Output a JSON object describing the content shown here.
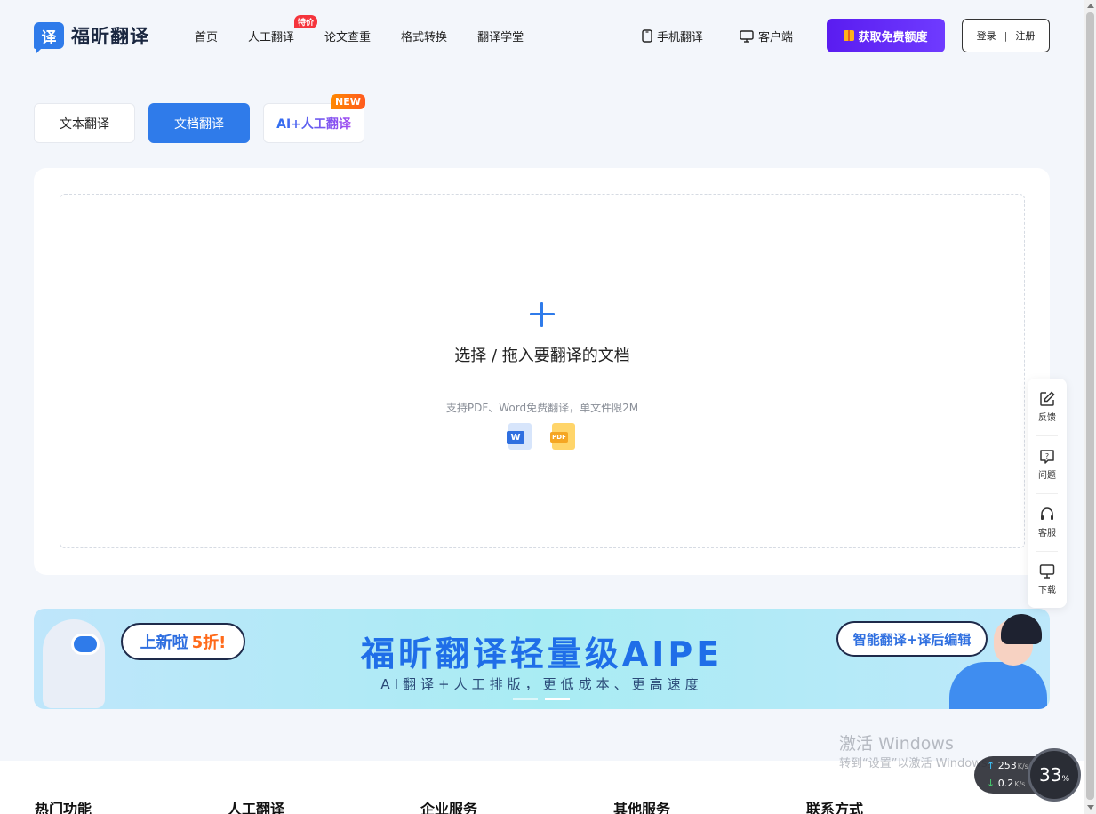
{
  "header": {
    "logo_glyph": "译",
    "logo_text": "福昕翻译",
    "nav": [
      {
        "label": "首页"
      },
      {
        "label": "人工翻译",
        "badge": "特价"
      },
      {
        "label": "论文查重"
      },
      {
        "label": "格式转换"
      },
      {
        "label": "翻译学堂"
      }
    ],
    "mobile_label": "手机翻译",
    "desktop_label": "客户端",
    "free_button": "获取免费额度",
    "login": "登录",
    "separator": "|",
    "register": "注册"
  },
  "tabs": {
    "text": "文本翻译",
    "doc": "文档翻译",
    "ai": "AI+人工翻译",
    "new_badge": "NEW",
    "active": "doc"
  },
  "upload": {
    "title": "选择 / 拖入要翻译的文档",
    "subtitle": "支持PDF、Word免费翻译，单文件限2M",
    "word_tag": "W",
    "pdf_tag": "PDF"
  },
  "banner": {
    "bubble_left": "上新啦",
    "bubble_left_highlight": "5折!",
    "title": "福昕翻译轻量级AIPE",
    "subtitle": "AI翻译+人工排版，更低成本、更高速度",
    "bubble_right": "智能翻译+译后编辑"
  },
  "footer": {
    "columns": [
      "热门功能",
      "人工翻译",
      "企业服务",
      "其他服务",
      "联系方式"
    ]
  },
  "side": {
    "items": [
      {
        "label": "反馈",
        "icon": "edit-icon"
      },
      {
        "label": "问题",
        "icon": "question-icon"
      },
      {
        "label": "客服",
        "icon": "headset-icon"
      },
      {
        "label": "下载",
        "icon": "monitor-icon"
      }
    ]
  },
  "watermark": {
    "line1": "激活 Windows",
    "line2": "转到“设置”以激活 Windows。"
  },
  "net": {
    "up_value": "253",
    "up_unit": "K/s",
    "down_value": "0.2",
    "down_unit": "K/s",
    "gauge_value": "33",
    "gauge_unit": "%"
  },
  "colors": {
    "primary": "#2f7bea",
    "cta": "#5a1cf0",
    "badge_red": "#f5343c",
    "badge_orange": "#ff8a00"
  }
}
